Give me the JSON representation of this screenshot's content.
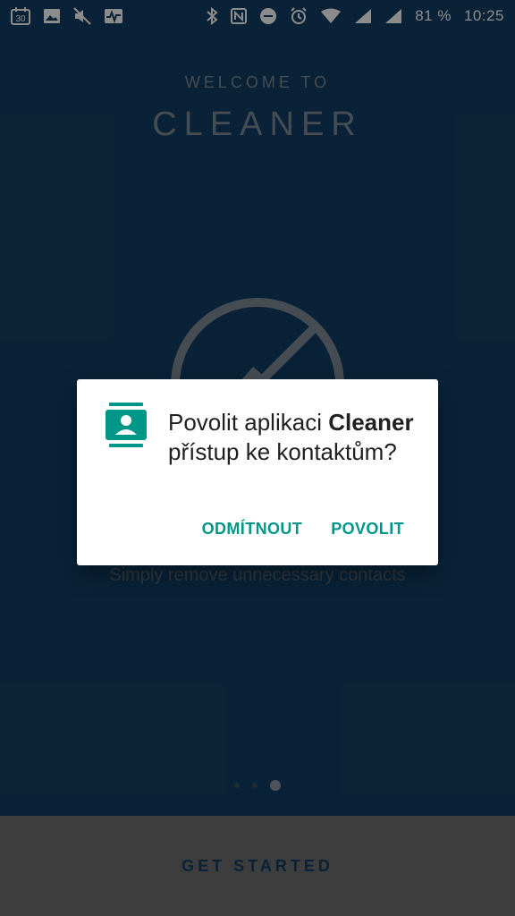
{
  "status_bar": {
    "left_icons": [
      "calendar-30-icon",
      "image-icon",
      "mute-icon",
      "activity-icon"
    ],
    "calendar_day": "30",
    "battery_text": "81 %",
    "time": "10:25"
  },
  "app": {
    "welcome": "WELCOME TO",
    "title": "CLEANER",
    "subtitle": "Simply remove unnecessary contacts",
    "pager": {
      "count": 3,
      "active_index": 2
    },
    "cta": "GET STARTED"
  },
  "dialog": {
    "message_part1": "Povolit aplikaci ",
    "message_app": "Cleaner",
    "message_part2": " přístup ke kontaktům?",
    "deny": "ODMÍTNOUT",
    "allow": "POVOLIT"
  },
  "colors": {
    "background": "#123f65",
    "accent": "#009688"
  }
}
